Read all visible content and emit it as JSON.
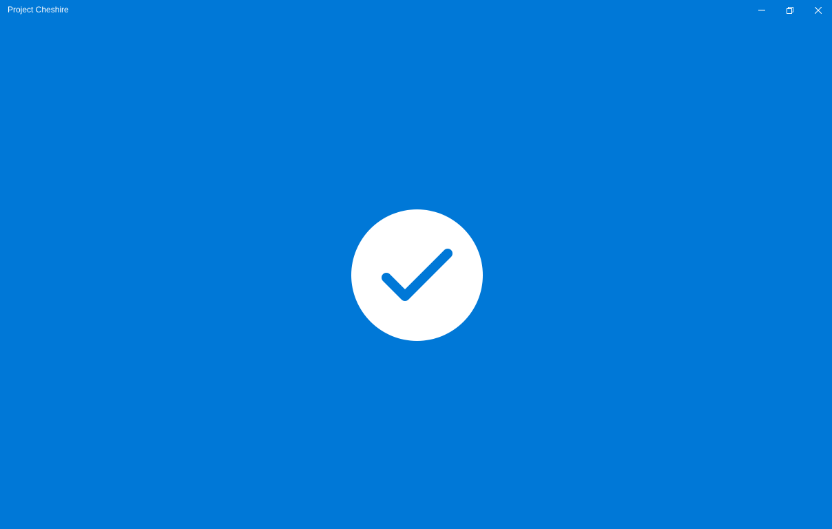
{
  "window": {
    "title": "Project Cheshire",
    "controls": {
      "minimize_icon": "minimize-icon",
      "restore_icon": "restore-icon",
      "close_icon": "close-icon"
    }
  },
  "main": {
    "status_icon": "check-circle-icon"
  },
  "colors": {
    "background": "#0078d7",
    "badge": "#ffffff",
    "checkmark": "#0078d7",
    "titlebar_text": "#ffffff"
  }
}
